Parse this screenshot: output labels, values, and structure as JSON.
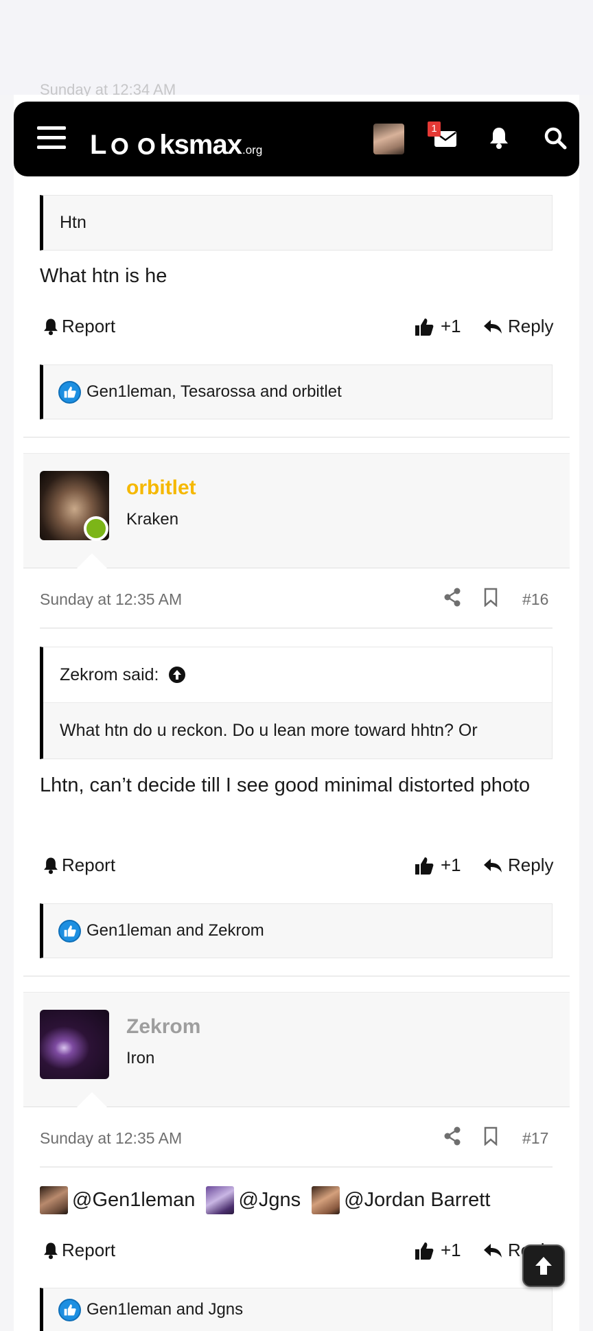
{
  "header": {
    "logo_main": "Lｏｏksmax",
    "logo_tld": ".org",
    "mail_badge": "1"
  },
  "ghost_previous": "Sunday at 12:34 AM",
  "post15": {
    "quote_body": "Htn",
    "message": "What htn is he",
    "report_label": "Report",
    "like_label": "+1",
    "reply_label": "Reply",
    "reactions": "Gen1leman, Tesarossa and orbitlet"
  },
  "post16": {
    "username": "orbitlet",
    "username_color": "#f5b800",
    "user_title": "Kraken",
    "date": "Sunday at 12:35 AM",
    "post_number": "#16",
    "quote_author": "Zekrom said:",
    "quote_body": "What htn do u reckon. Do u lean more toward hhtn? Or",
    "message": "Lhtn, can’t decide till I see good minimal distorted photo",
    "report_label": "Report",
    "like_label": "+1",
    "reply_label": "Reply",
    "reactions": "Gen1leman and Zekrom"
  },
  "post17": {
    "username": "Zekrom",
    "username_color": "#9e9e9e",
    "user_title": "Iron",
    "date": "Sunday at 12:35 AM",
    "post_number": "#17",
    "mentions": [
      "@Gen1leman",
      "@Jgns",
      "@Jordan Barrett"
    ],
    "report_label": "Report",
    "like_label": "+1",
    "reply_label": "Reply",
    "reactions": "Gen1leman and Jgns"
  }
}
